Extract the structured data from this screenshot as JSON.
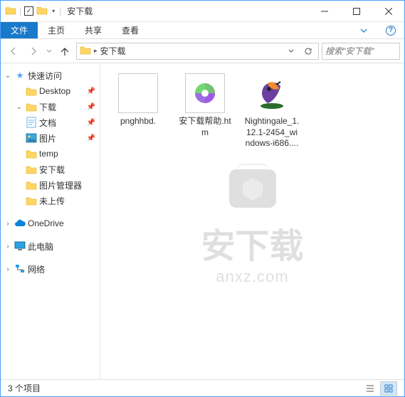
{
  "titlebar": {
    "title": "安下载"
  },
  "ribbon": {
    "file": "文件",
    "tabs": [
      "主页",
      "共享",
      "查看"
    ]
  },
  "nav": {
    "breadcrumb": "安下载",
    "search_placeholder": "搜索\"安下载\""
  },
  "sidebar": {
    "quick_access": "快速访问",
    "items": [
      {
        "label": "Desktop",
        "icon": "folder",
        "pinned": true
      },
      {
        "label": "下载",
        "icon": "folder",
        "pinned": true,
        "expanded": true
      },
      {
        "label": "文档",
        "icon": "document",
        "pinned": true
      },
      {
        "label": "图片",
        "icon": "pictures",
        "pinned": true
      },
      {
        "label": "temp",
        "icon": "folder",
        "pinned": false
      },
      {
        "label": "安下载",
        "icon": "folder",
        "pinned": false
      },
      {
        "label": "图片管理器",
        "icon": "folder",
        "pinned": false
      },
      {
        "label": "未上传",
        "icon": "folder",
        "pinned": false
      }
    ],
    "onedrive": "OneDrive",
    "this_pc": "此电脑",
    "network": "网络"
  },
  "files": [
    {
      "label": "pnghhbd.",
      "type": "blank"
    },
    {
      "label": "安下载帮助.htm",
      "type": "html"
    },
    {
      "label": "Nightingale_1.12.1-2454_windows-i686....",
      "type": "app"
    }
  ],
  "statusbar": {
    "count": "3 个项目"
  },
  "watermark": {
    "main": "安下载",
    "sub": "anxz.com"
  }
}
